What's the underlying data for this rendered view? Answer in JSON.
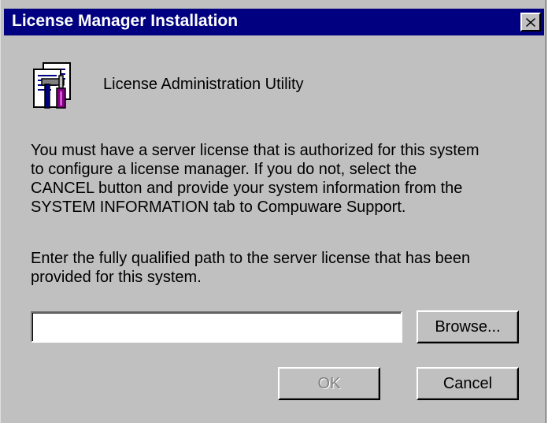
{
  "window": {
    "title": "License Manager Installation",
    "close_icon": "close-icon"
  },
  "header": {
    "icon": "license-utility-icon",
    "label": "License Administration Utility"
  },
  "message": {
    "lines": [
      "You must have a server license that is authorized for this system",
      "to configure a license manager.  If you do not, select the",
      "CANCEL button and provide your system information from the",
      "SYSTEM INFORMATION tab to Compuware Support."
    ]
  },
  "prompt": {
    "lines": [
      "Enter the fully qualified path to the server license that has been",
      "provided for this system."
    ]
  },
  "path_field": {
    "value": ""
  },
  "buttons": {
    "browse": "Browse...",
    "ok": "OK",
    "cancel": "Cancel"
  },
  "colors": {
    "titlebar": "#000080",
    "face": "#c0c0c0",
    "disabled_text": "#808080"
  }
}
